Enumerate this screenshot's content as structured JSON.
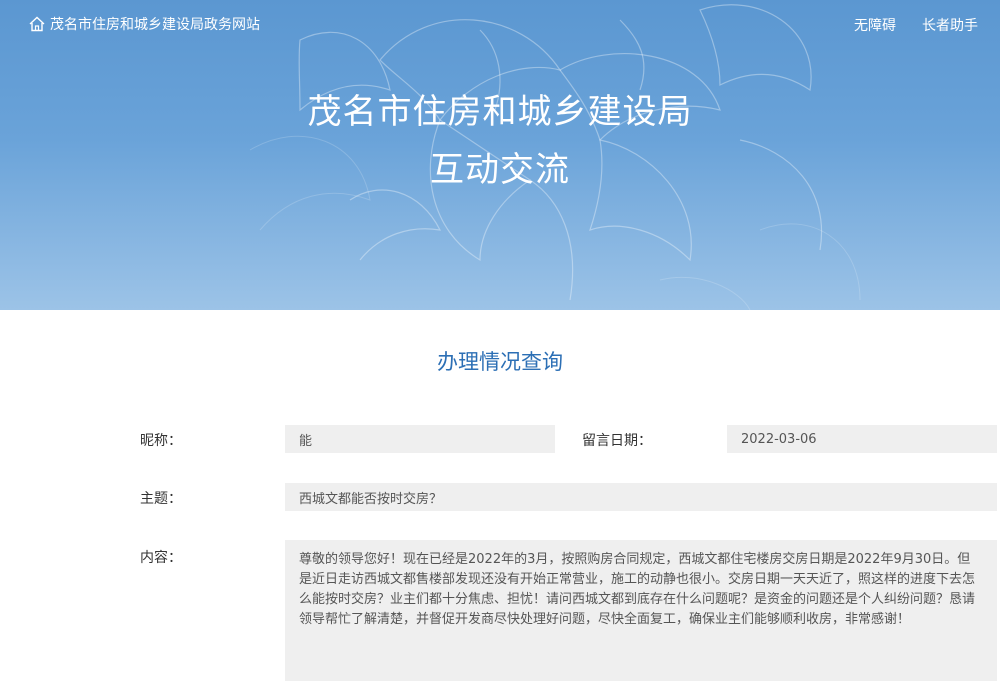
{
  "header": {
    "site_name": "茂名市住房和城乡建设局政务网站",
    "accessibility": "无障碍",
    "elderly_helper": "长者助手",
    "title_line1": "茂名市住房和城乡建设局",
    "title_line2": "互动交流"
  },
  "main": {
    "section_title": "办理情况查询",
    "nickname_label": "昵称：",
    "nickname_value": "能",
    "date_label": "留言日期：",
    "date_value": "2022-03-06",
    "subject_label": "主题：",
    "subject_value": "西城文都能否按时交房？",
    "content_label": "内容：",
    "content_value": "尊敬的领导您好！现在已经是2022年的3月，按照购房合同规定，西城文都住宅楼房交房日期是2022年9月30日。但是近日走访西城文都售楼部发现还没有开始正常营业，施工的动静也很小。交房日期一天天近了，照这样的进度下去怎么能按时交房？业主们都十分焦虑、担忧！请问西城文都到底存在什么问题呢？是资金的问题还是个人纠纷问题？恳请领导帮忙了解清楚，并督促开发商尽快处理好问题，尽快全面复工，确保业主们能够顺利收房，非常感谢！"
  },
  "icons": {
    "home": "home-icon"
  },
  "colors": {
    "hero_blue": "#5b97d1",
    "title_blue": "#2c6fb5",
    "field_bg": "#efefef"
  }
}
